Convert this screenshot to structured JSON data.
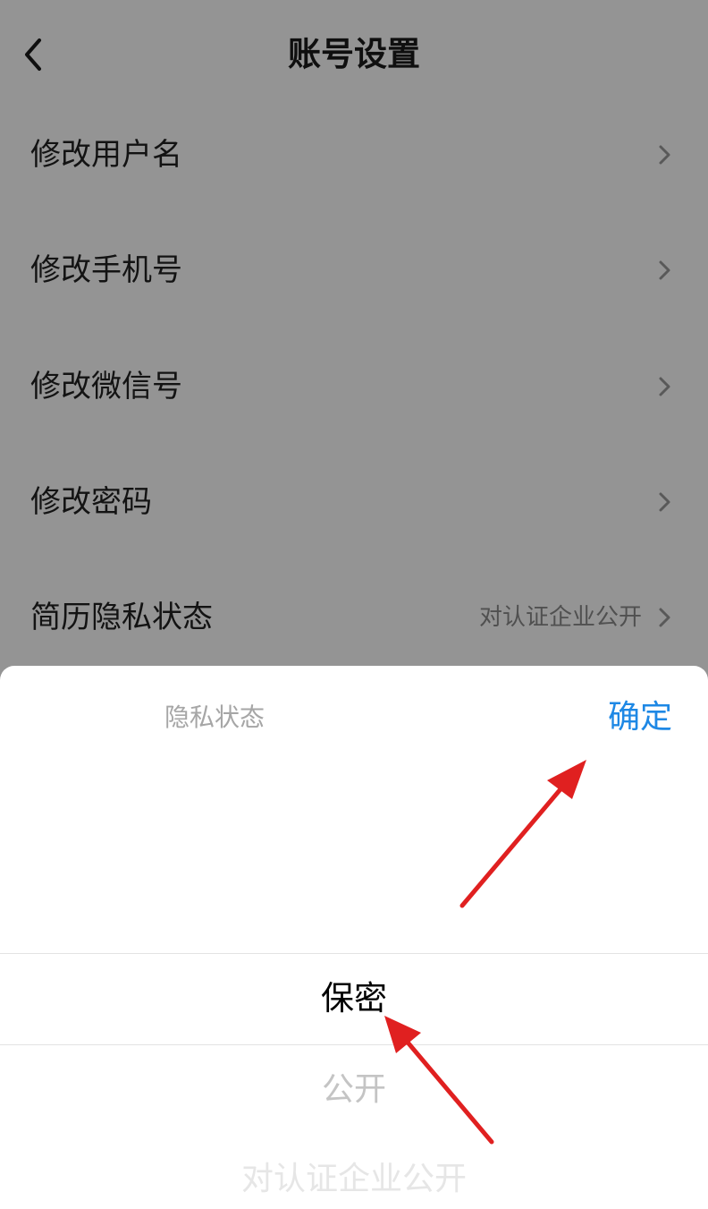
{
  "header": {
    "back_icon": "chevron-left-icon",
    "title": "账号设置"
  },
  "settings": [
    {
      "label": "修改用户名",
      "value": ""
    },
    {
      "label": "修改手机号",
      "value": ""
    },
    {
      "label": "修改微信号",
      "value": ""
    },
    {
      "label": "修改密码",
      "value": ""
    },
    {
      "label": "简历隐私状态",
      "value": "对认证企业公开"
    }
  ],
  "picker": {
    "title": "隐私状态",
    "confirm_label": "确定",
    "options": [
      "保密",
      "公开",
      "对认证企业公开"
    ],
    "selected": "保密"
  },
  "colors": {
    "overlay": "rgba(0,0,0,0.42)",
    "confirm": "#1e88e5",
    "annotation_arrow": "#e02020"
  }
}
